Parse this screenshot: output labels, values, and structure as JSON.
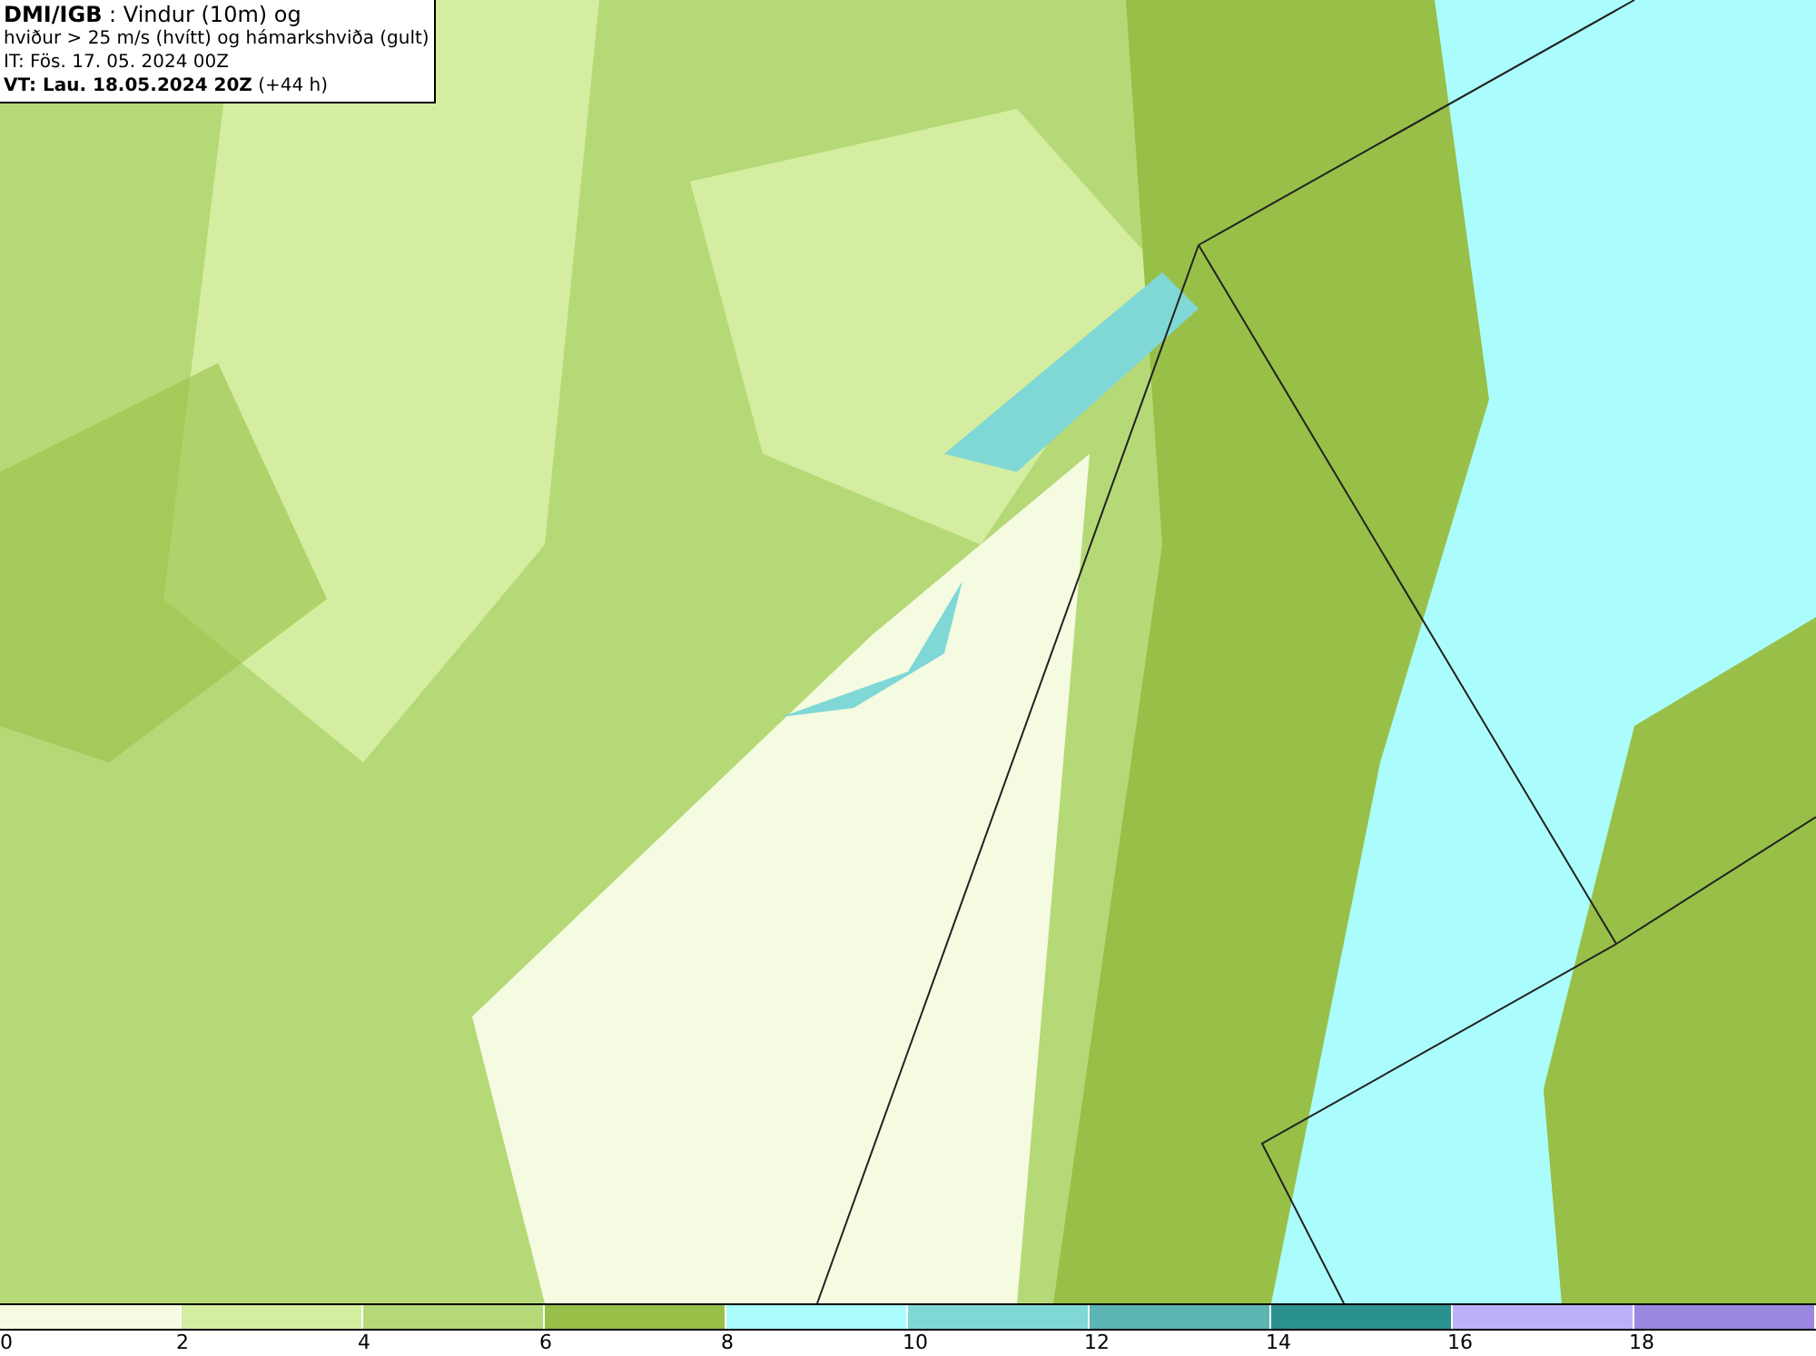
{
  "header": {
    "lines": [
      "**DMI/IGB** : Vindur (10m) og",
      "hviður > 25 m/s (hvítt) og hámarkshviða (gult)",
      "IT: Fös. 17. 05. 2024 00Z",
      "**VT: Lau. 18.05.2024 20Z** (+44 h)"
    ]
  },
  "legend": [
    {
      "label": "0",
      "color": "#f5fbe1"
    },
    {
      "label": "2",
      "color": "#d4eda0"
    },
    {
      "label": "4",
      "color": "#b6d977"
    },
    {
      "label": "6",
      "color": "#98bf47"
    },
    {
      "label": "8",
      "color": "#aafdfc"
    },
    {
      "label": "10",
      "color": "#80d8d6"
    },
    {
      "label": "12",
      "color": "#5cb5b3"
    },
    {
      "label": "14",
      "color": "#2b918e"
    },
    {
      "label": "16",
      "color": "#bdb0f7"
    },
    {
      "label": "18",
      "color": "#9c87df"
    }
  ]
}
